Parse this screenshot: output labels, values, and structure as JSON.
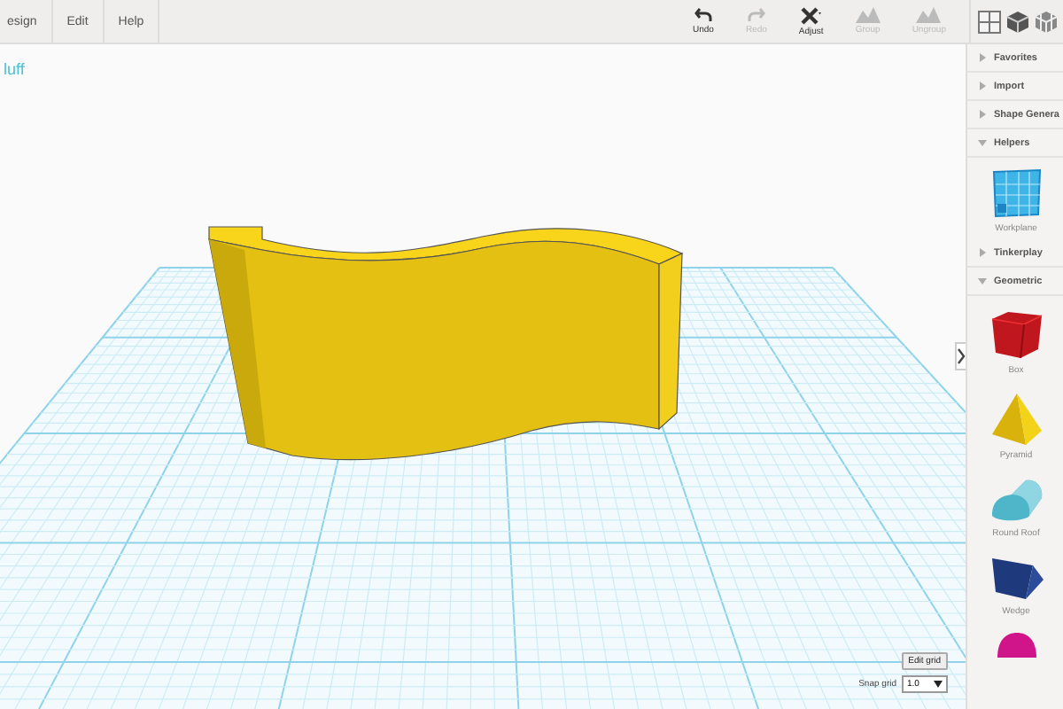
{
  "menu": [
    {
      "label": "esign"
    },
    {
      "label": "Edit"
    },
    {
      "label": "Help"
    }
  ],
  "toolbar": [
    {
      "kind": "undo",
      "label": "Undo",
      "disabled": false
    },
    {
      "kind": "redo",
      "label": "Redo",
      "disabled": true
    },
    {
      "kind": "adjust",
      "label": "Adjust",
      "disabled": false
    },
    {
      "kind": "group",
      "label": "Group",
      "disabled": true
    },
    {
      "kind": "ungroup",
      "label": "Ungroup",
      "disabled": true
    }
  ],
  "design_title": "luff",
  "grid_controls": {
    "edit_button": "Edit grid",
    "snap_label": "Snap grid",
    "snap_value": "1.0"
  },
  "sidebar": {
    "sections": [
      {
        "label": "Favorites",
        "expanded": false
      },
      {
        "label": "Import",
        "expanded": false
      },
      {
        "label": "Shape Genera",
        "expanded": false
      },
      {
        "label": "Helpers",
        "expanded": true,
        "items": [
          {
            "kind": "workplane",
            "label": "Workplane"
          }
        ]
      },
      {
        "label": "Tinkerplay",
        "expanded": false
      },
      {
        "label": "Geometric",
        "expanded": true,
        "items": [
          {
            "kind": "box",
            "label": "Box"
          },
          {
            "kind": "pyramid",
            "label": "Pyramid"
          },
          {
            "kind": "roof",
            "label": "Round Roof"
          },
          {
            "kind": "wedge",
            "label": "Wedge"
          },
          {
            "kind": "dome"
          }
        ]
      }
    ]
  }
}
